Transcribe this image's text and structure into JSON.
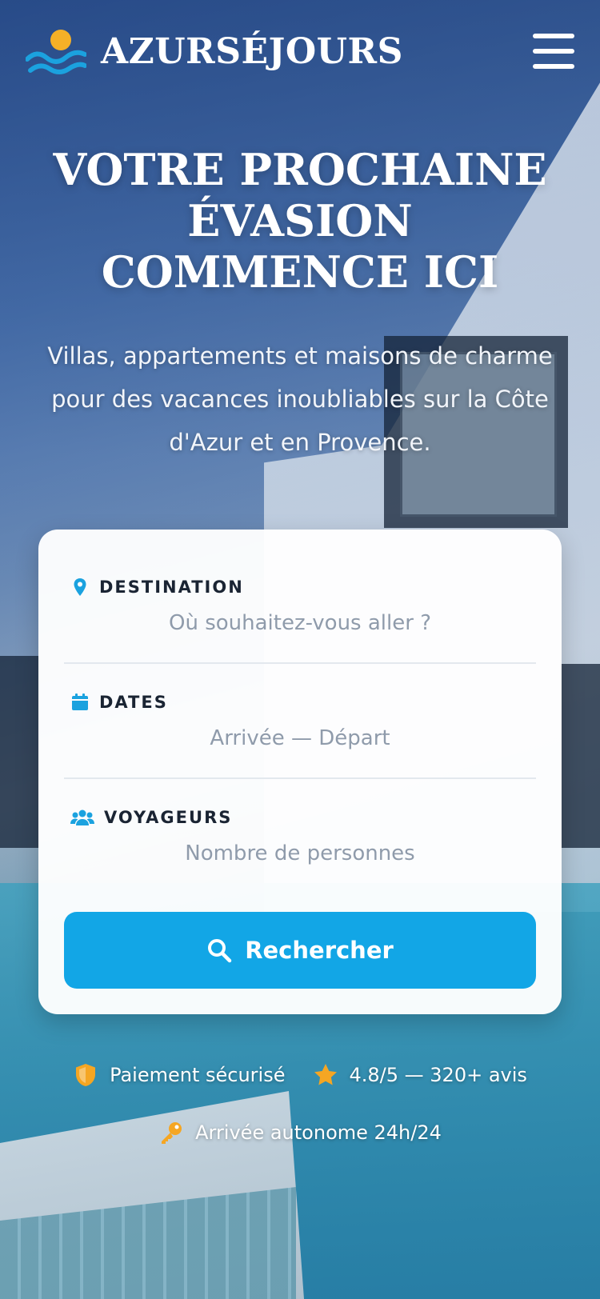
{
  "brand": {
    "name": "AZURSÉJOURS"
  },
  "hero": {
    "title": "VOTRE PROCHAINE ÉVASION COMMENCE ICI",
    "subtitle": "Villas, appartements et maisons de charme pour des vacances inoubliables sur la Côte d'Azur et en Provence."
  },
  "search": {
    "destination": {
      "label": "DESTINATION",
      "placeholder": "Où souhaitez-vous aller ?",
      "icon": "map-pin-icon"
    },
    "dates": {
      "label": "DATES",
      "placeholder": "Arrivée — Départ",
      "icon": "calendar-icon"
    },
    "travelers": {
      "label": "VOYAGEURS",
      "placeholder": "Nombre de personnes",
      "icon": "users-icon"
    },
    "button_label": "Rechercher"
  },
  "badges": [
    {
      "text": "Paiement sécurisé",
      "icon": "shield-icon"
    },
    {
      "text": "4.8/5 — 320+ avis",
      "icon": "star-icon"
    },
    {
      "text": "Arrivée autonome 24h/24",
      "icon": "key-icon"
    }
  ],
  "colors": {
    "accent": "#12a6e6",
    "icon_blue": "#1ba2df",
    "badge_orange": "#f5a623",
    "logo_sun": "#f5b027"
  }
}
